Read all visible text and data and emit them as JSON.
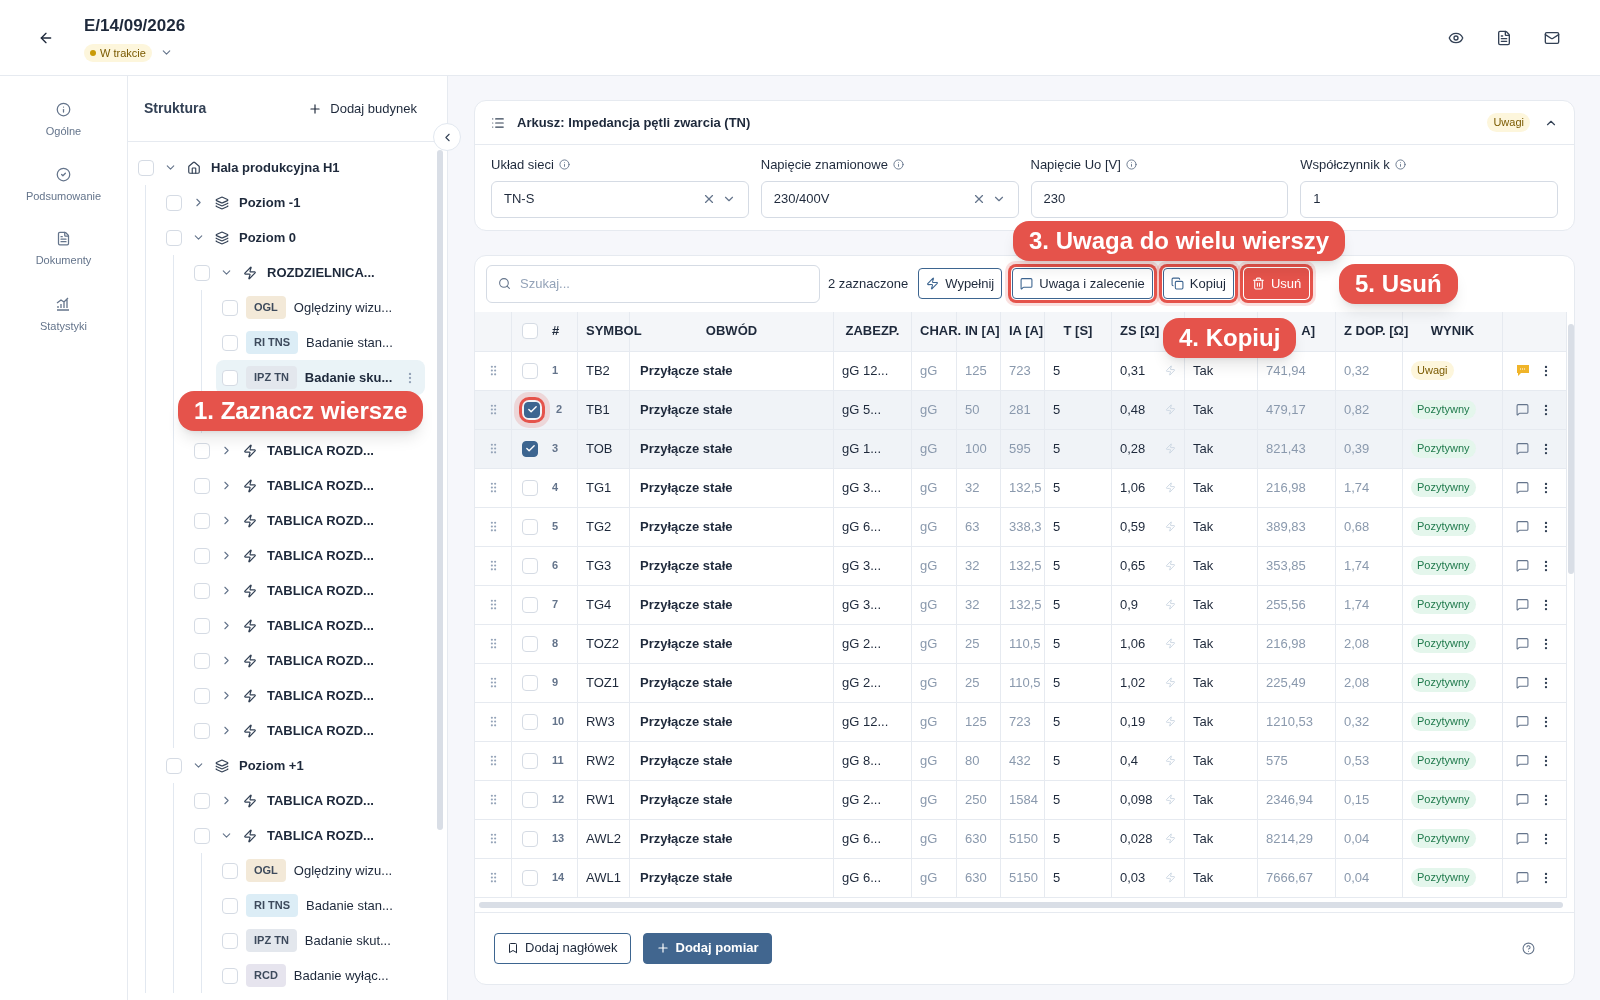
{
  "header": {
    "title": "E/14/09/2026",
    "status": {
      "label": "W trakcie",
      "color": "#c99a06"
    }
  },
  "nav": [
    {
      "label": "Ogólne"
    },
    {
      "label": "Podsumowanie"
    },
    {
      "label": "Dokumenty"
    },
    {
      "label": "Statystyki"
    }
  ],
  "tree": {
    "title": "Struktura",
    "add_label": "Dodaj budynek",
    "items": [
      {
        "kind": "building",
        "label": "Hala produkcyjna H1",
        "expanded": true,
        "selected": false,
        "children": [
          {
            "kind": "level",
            "label": "Poziom -1",
            "expanded": false,
            "selected": false
          },
          {
            "kind": "level",
            "label": "Poziom 0",
            "expanded": true,
            "selected": false,
            "children": [
              {
                "kind": "board",
                "label": "ROZDZIELNICA...",
                "expanded": true,
                "selected": false,
                "children": [
                  {
                    "kind": "test",
                    "tag": "OGL",
                    "color": "#f3e9d8",
                    "label": "Oględziny wizu...",
                    "selected": false
                  },
                  {
                    "kind": "test",
                    "tag": "RI TNS",
                    "color": "#dcedf6",
                    "label": "Badanie stan...",
                    "selected": false
                  },
                  {
                    "kind": "test",
                    "tag": "IPZ TN",
                    "color": "#e3e7ed",
                    "label": "Badanie sku...",
                    "selected": true,
                    "callout": "1. Zaznacz wiersze"
                  }
                ]
              },
              {
                "kind": "board",
                "label": "TABLICA ROZD...",
                "expanded": false,
                "selected": false
              },
              {
                "kind": "board",
                "label": "TABLICA ROZD...",
                "expanded": false,
                "selected": false
              },
              {
                "kind": "board",
                "label": "TABLICA ROZD...",
                "expanded": false,
                "selected": false
              },
              {
                "kind": "board",
                "label": "TABLICA ROZD...",
                "expanded": false,
                "selected": false
              },
              {
                "kind": "board",
                "label": "TABLICA ROZD...",
                "expanded": false,
                "selected": false
              },
              {
                "kind": "board",
                "label": "TABLICA ROZD...",
                "expanded": false,
                "selected": false
              },
              {
                "kind": "board",
                "label": "TABLICA ROZD...",
                "expanded": false,
                "selected": false
              },
              {
                "kind": "board",
                "label": "TABLICA ROZD...",
                "expanded": false,
                "selected": false
              },
              {
                "kind": "board",
                "label": "TABLICA ROZD...",
                "expanded": false,
                "selected": false
              }
            ]
          },
          {
            "kind": "level",
            "label": "Poziom +1",
            "expanded": true,
            "selected": false,
            "children": [
              {
                "kind": "board",
                "label": "TABLICA ROZD...",
                "expanded": false,
                "selected": false
              },
              {
                "kind": "board",
                "label": "TABLICA ROZD...",
                "expanded": true,
                "selected": false,
                "children": [
                  {
                    "kind": "test",
                    "tag": "OGL",
                    "color": "#f3e9d8",
                    "label": "Oględziny wizu...",
                    "selected": false
                  },
                  {
                    "kind": "test",
                    "tag": "RI TNS",
                    "color": "#dcedf6",
                    "label": "Badanie stan...",
                    "selected": false
                  },
                  {
                    "kind": "test",
                    "tag": "IPZ TN",
                    "color": "#e3e7ed",
                    "label": "Badanie skut...",
                    "selected": false
                  },
                  {
                    "kind": "test",
                    "tag": "RCD",
                    "color": "#e6e4ee",
                    "label": "Badanie wyłąc...",
                    "selected": false
                  }
                ]
              }
            ]
          }
        ]
      }
    ]
  },
  "sheet": {
    "title": "Arkusz: Impedancja pętli zwarcia (TN)",
    "badge": "Uwagi",
    "expanded": true,
    "fields": [
      {
        "kind": "select",
        "label": "Układ sieci",
        "value": "TN-S"
      },
      {
        "kind": "select",
        "label": "Napięcie znamionowe",
        "value": "230/400V"
      },
      {
        "kind": "input",
        "label": "Napięcie Uo [V]",
        "value": "230"
      },
      {
        "kind": "input",
        "label": "Współczynnik k",
        "value": "1"
      }
    ]
  },
  "toolbar": {
    "search_placeholder": "Szukaj...",
    "selected_count": "2 zaznaczone",
    "buttons": [
      {
        "kind": "fill",
        "label": "Wypełnij",
        "highlighted": false
      },
      {
        "kind": "note",
        "label": "Uwaga i zalecenie",
        "highlighted": true
      },
      {
        "kind": "copy",
        "label": "Kopiuj",
        "highlighted": true
      },
      {
        "kind": "delete",
        "label": "Usuń",
        "highlighted": true
      }
    ]
  },
  "callouts": [
    {
      "label": "3. Uwaga do wielu wierszy"
    },
    {
      "label": "5. Usuń"
    },
    {
      "label": "4. Kopiuj"
    }
  ],
  "table": {
    "select_all": {
      "checked": false
    },
    "columns": [
      {
        "label": "#"
      },
      {
        "label": "SYMBOL"
      },
      {
        "label": "OBWÓD"
      },
      {
        "label": "ZABEZP."
      },
      {
        "label": "CHAR."
      },
      {
        "label": "IN [A]"
      },
      {
        "label": "IA [A]"
      },
      {
        "label": "T [S]"
      },
      {
        "label": "ZS [Ω]"
      },
      {
        "covered": true
      },
      {
        "label": "A]"
      },
      {
        "label": "Z DOP. [Ω]"
      },
      {
        "label": "WYNIK"
      }
    ],
    "rows": [
      {
        "n": "1",
        "symbol": "TB2",
        "circuit": "Przyłącze stałe",
        "protection": "gG 12...",
        "char": "gG",
        "in": "125",
        "ia": "723",
        "t": "5",
        "zs": "0,31",
        "ok": "Tak",
        "ik": "741,94",
        "zdop": "0,32",
        "result": {
          "kind": "warn",
          "label": "Uwagi"
        },
        "has_note": true,
        "selected": false,
        "highlighted": false
      },
      {
        "n": "2",
        "symbol": "TB1",
        "circuit": "Przyłącze stałe",
        "protection": "gG 5...",
        "char": "gG",
        "in": "50",
        "ia": "281",
        "t": "5",
        "zs": "0,48",
        "ok": "Tak",
        "ik": "479,17",
        "zdop": "0,82",
        "result": {
          "kind": "ok",
          "label": "Pozytywny"
        },
        "has_note": false,
        "selected": true,
        "highlighted": true
      },
      {
        "n": "3",
        "symbol": "TOB",
        "circuit": "Przyłącze stałe",
        "protection": "gG 1...",
        "char": "gG",
        "in": "100",
        "ia": "595",
        "t": "5",
        "zs": "0,28",
        "ok": "Tak",
        "ik": "821,43",
        "zdop": "0,39",
        "result": {
          "kind": "ok",
          "label": "Pozytywny"
        },
        "has_note": false,
        "selected": true,
        "highlighted": false
      },
      {
        "n": "4",
        "symbol": "TG1",
        "circuit": "Przyłącze stałe",
        "protection": "gG 3...",
        "char": "gG",
        "in": "32",
        "ia": "132,5",
        "t": "5",
        "zs": "1,06",
        "ok": "Tak",
        "ik": "216,98",
        "zdop": "1,74",
        "result": {
          "kind": "ok",
          "label": "Pozytywny"
        },
        "has_note": false,
        "selected": false,
        "highlighted": false
      },
      {
        "n": "5",
        "symbol": "TG2",
        "circuit": "Przyłącze stałe",
        "protection": "gG 6...",
        "char": "gG",
        "in": "63",
        "ia": "338,3",
        "t": "5",
        "zs": "0,59",
        "ok": "Tak",
        "ik": "389,83",
        "zdop": "0,68",
        "result": {
          "kind": "ok",
          "label": "Pozytywny"
        },
        "has_note": false,
        "selected": false,
        "highlighted": false
      },
      {
        "n": "6",
        "symbol": "TG3",
        "circuit": "Przyłącze stałe",
        "protection": "gG 3...",
        "char": "gG",
        "in": "32",
        "ia": "132,5",
        "t": "5",
        "zs": "0,65",
        "ok": "Tak",
        "ik": "353,85",
        "zdop": "1,74",
        "result": {
          "kind": "ok",
          "label": "Pozytywny"
        },
        "has_note": false,
        "selected": false,
        "highlighted": false
      },
      {
        "n": "7",
        "symbol": "TG4",
        "circuit": "Przyłącze stałe",
        "protection": "gG 3...",
        "char": "gG",
        "in": "32",
        "ia": "132,5",
        "t": "5",
        "zs": "0,9",
        "ok": "Tak",
        "ik": "255,56",
        "zdop": "1,74",
        "result": {
          "kind": "ok",
          "label": "Pozytywny"
        },
        "has_note": false,
        "selected": false,
        "highlighted": false
      },
      {
        "n": "8",
        "symbol": "TOZ2",
        "circuit": "Przyłącze stałe",
        "protection": "gG 2...",
        "char": "gG",
        "in": "25",
        "ia": "110,5",
        "t": "5",
        "zs": "1,06",
        "ok": "Tak",
        "ik": "216,98",
        "zdop": "2,08",
        "result": {
          "kind": "ok",
          "label": "Pozytywny"
        },
        "has_note": false,
        "selected": false,
        "highlighted": false
      },
      {
        "n": "9",
        "symbol": "TOZ1",
        "circuit": "Przyłącze stałe",
        "protection": "gG 2...",
        "char": "gG",
        "in": "25",
        "ia": "110,5",
        "t": "5",
        "zs": "1,02",
        "ok": "Tak",
        "ik": "225,49",
        "zdop": "2,08",
        "result": {
          "kind": "ok",
          "label": "Pozytywny"
        },
        "has_note": false,
        "selected": false,
        "highlighted": false
      },
      {
        "n": "10",
        "symbol": "RW3",
        "circuit": "Przyłącze stałe",
        "protection": "gG 12...",
        "char": "gG",
        "in": "125",
        "ia": "723",
        "t": "5",
        "zs": "0,19",
        "ok": "Tak",
        "ik": "1210,53",
        "zdop": "0,32",
        "result": {
          "kind": "ok",
          "label": "Pozytywny"
        },
        "has_note": false,
        "selected": false,
        "highlighted": false
      },
      {
        "n": "11",
        "symbol": "RW2",
        "circuit": "Przyłącze stałe",
        "protection": "gG 8...",
        "char": "gG",
        "in": "80",
        "ia": "432",
        "t": "5",
        "zs": "0,4",
        "ok": "Tak",
        "ik": "575",
        "zdop": "0,53",
        "result": {
          "kind": "ok",
          "label": "Pozytywny"
        },
        "has_note": false,
        "selected": false,
        "highlighted": false
      },
      {
        "n": "12",
        "symbol": "RW1",
        "circuit": "Przyłącze stałe",
        "protection": "gG 2...",
        "char": "gG",
        "in": "250",
        "ia": "1584",
        "t": "5",
        "zs": "0,098",
        "ok": "Tak",
        "ik": "2346,94",
        "zdop": "0,15",
        "result": {
          "kind": "ok",
          "label": "Pozytywny"
        },
        "has_note": false,
        "selected": false,
        "highlighted": false
      },
      {
        "n": "13",
        "symbol": "AWL2",
        "circuit": "Przyłącze stałe",
        "protection": "gG 6...",
        "char": "gG",
        "in": "630",
        "ia": "5150",
        "t": "5",
        "zs": "0,028",
        "ok": "Tak",
        "ik": "8214,29",
        "zdop": "0,04",
        "result": {
          "kind": "ok",
          "label": "Pozytywny"
        },
        "has_note": false,
        "selected": false,
        "highlighted": false
      },
      {
        "n": "14",
        "symbol": "AWL1",
        "circuit": "Przyłącze stałe",
        "protection": "gG 6...",
        "char": "gG",
        "in": "630",
        "ia": "5150",
        "t": "5",
        "zs": "0,03",
        "ok": "Tak",
        "ik": "7666,67",
        "zdop": "0,04",
        "result": {
          "kind": "ok",
          "label": "Pozytywny"
        },
        "has_note": false,
        "selected": false,
        "highlighted": false
      }
    ]
  },
  "footer": {
    "buttons": [
      {
        "kind": "header",
        "label": "Dodaj nagłówek"
      },
      {
        "kind": "measure",
        "label": "Dodaj pomiar"
      }
    ]
  }
}
